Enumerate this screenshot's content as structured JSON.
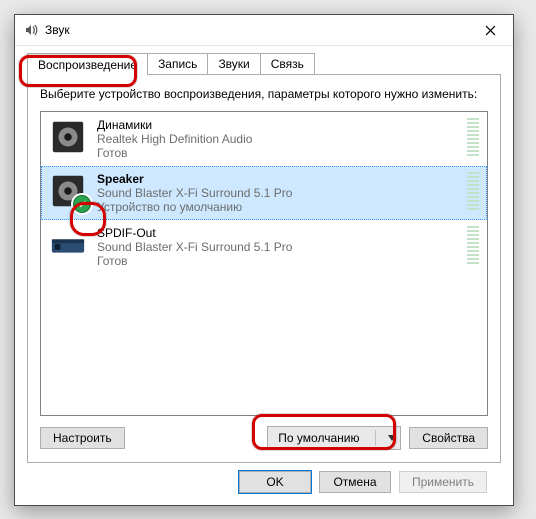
{
  "window": {
    "title": "Звук",
    "close_tooltip": "Закрыть"
  },
  "tabs": [
    {
      "label": "Воспроизведение",
      "active": true
    },
    {
      "label": "Запись",
      "active": false
    },
    {
      "label": "Звуки",
      "active": false
    },
    {
      "label": "Связь",
      "active": false
    }
  ],
  "instruction": "Выберите устройство воспроизведения, параметры которого нужно изменить:",
  "devices": [
    {
      "name": "Динамики",
      "details": "Realtek High Definition Audio",
      "status": "Готов",
      "default": false,
      "selected": false,
      "icon": "speaker-black"
    },
    {
      "name": "Speaker",
      "details": "Sound Blaster X-Fi Surround 5.1 Pro",
      "status": "Устройство по умолчанию",
      "default": true,
      "selected": true,
      "icon": "speaker-black"
    },
    {
      "name": "SPDIF-Out",
      "details": "Sound Blaster X-Fi Surround 5.1 Pro",
      "status": "Готов",
      "default": false,
      "selected": false,
      "icon": "spdif"
    }
  ],
  "panel_buttons": {
    "configure": "Настроить",
    "set_default": "По умолчанию",
    "properties": "Свойства"
  },
  "dialog_buttons": {
    "ok": "OK",
    "cancel": "Отмена",
    "apply": "Применить"
  }
}
